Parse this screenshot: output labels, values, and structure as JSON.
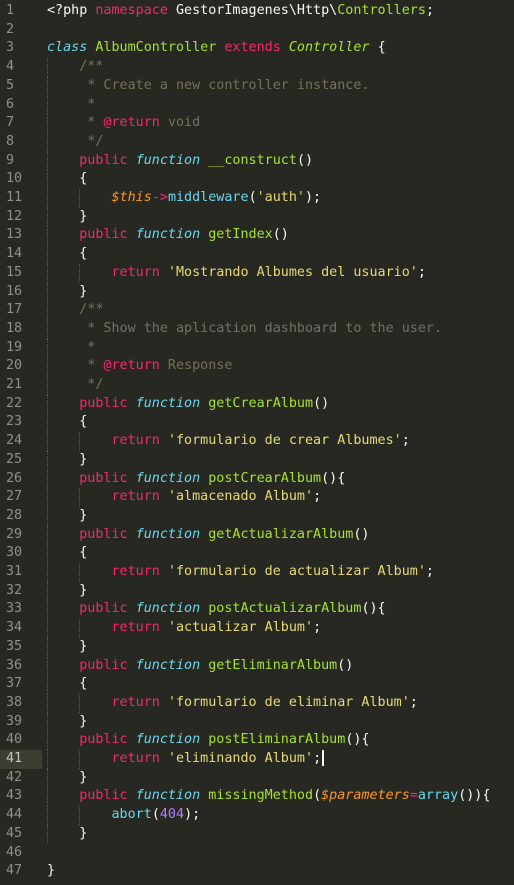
{
  "editor": {
    "theme": "monokai",
    "colors": {
      "background": "#272822",
      "line_number": "#90908a",
      "current_line": "#3e3d32",
      "keyword": "#f92672",
      "storage": "#66d9ef",
      "function_name": "#a6e22e",
      "string": "#e6db74",
      "comment": "#75715e",
      "variable": "#fd971f",
      "number": "#ae81ff"
    },
    "current_line": 41,
    "lines": [
      {
        "n": "1",
        "guides": 0,
        "tokens": [
          [
            "plain",
            "<?php "
          ],
          [
            "kw",
            "namespace "
          ],
          [
            "plain",
            "GestorImagenes\\Http\\"
          ],
          [
            "class",
            "Controllers"
          ],
          [
            "plain",
            ";"
          ]
        ]
      },
      {
        "n": "2",
        "guides": 0,
        "tokens": []
      },
      {
        "n": "3",
        "guides": 0,
        "tokens": [
          [
            "storage",
            "class "
          ],
          [
            "class",
            "AlbumController "
          ],
          [
            "kw",
            "extends "
          ],
          [
            "inherit",
            "Controller "
          ],
          [
            "plain",
            "{"
          ]
        ]
      },
      {
        "n": "4",
        "guides": 1,
        "tokens": [
          [
            "plain",
            "    "
          ],
          [
            "comment",
            "/**"
          ]
        ]
      },
      {
        "n": "5",
        "guides": 1,
        "tokens": [
          [
            "plain",
            "    "
          ],
          [
            "comment",
            " * Create a new controller instance."
          ]
        ]
      },
      {
        "n": "6",
        "guides": 1,
        "tokens": [
          [
            "plain",
            "    "
          ],
          [
            "comment",
            " *"
          ]
        ]
      },
      {
        "n": "7",
        "guides": 1,
        "tokens": [
          [
            "plain",
            "    "
          ],
          [
            "comment",
            " * "
          ],
          [
            "kw",
            "@return"
          ],
          [
            "comment",
            " void"
          ]
        ]
      },
      {
        "n": "8",
        "guides": 1,
        "tokens": [
          [
            "plain",
            "    "
          ],
          [
            "comment",
            " */"
          ]
        ]
      },
      {
        "n": "9",
        "guides": 1,
        "tokens": [
          [
            "plain",
            "    "
          ],
          [
            "kw",
            "public "
          ],
          [
            "storage",
            "function "
          ],
          [
            "func",
            "__construct"
          ],
          [
            "plain",
            "()"
          ]
        ]
      },
      {
        "n": "10",
        "guides": 1,
        "tokens": [
          [
            "plain",
            "    {"
          ]
        ]
      },
      {
        "n": "11",
        "guides": 2,
        "tokens": [
          [
            "plain",
            "        "
          ],
          [
            "var",
            "$this"
          ],
          [
            "kw",
            "->"
          ],
          [
            "support",
            "middleware"
          ],
          [
            "plain",
            "("
          ],
          [
            "string",
            "'auth'"
          ],
          [
            "plain",
            ");"
          ]
        ]
      },
      {
        "n": "12",
        "guides": 1,
        "tokens": [
          [
            "plain",
            "    }"
          ]
        ]
      },
      {
        "n": "13",
        "guides": 1,
        "tokens": [
          [
            "plain",
            "    "
          ],
          [
            "kw",
            "public "
          ],
          [
            "storage",
            "function "
          ],
          [
            "func",
            "getIndex"
          ],
          [
            "plain",
            "()"
          ]
        ]
      },
      {
        "n": "14",
        "guides": 1,
        "tokens": [
          [
            "plain",
            "    {"
          ]
        ]
      },
      {
        "n": "15",
        "guides": 2,
        "tokens": [
          [
            "plain",
            "        "
          ],
          [
            "kw",
            "return "
          ],
          [
            "string",
            "'Mostrando Albumes del usuario'"
          ],
          [
            "plain",
            ";"
          ]
        ]
      },
      {
        "n": "16",
        "guides": 1,
        "tokens": [
          [
            "plain",
            "    }"
          ]
        ]
      },
      {
        "n": "17",
        "guides": 1,
        "tokens": [
          [
            "plain",
            "    "
          ],
          [
            "comment",
            "/**"
          ]
        ]
      },
      {
        "n": "18",
        "guides": 1,
        "tokens": [
          [
            "plain",
            "    "
          ],
          [
            "comment",
            " * Show the aplication dashboard to the user."
          ]
        ]
      },
      {
        "n": "19",
        "guides": 1,
        "tokens": [
          [
            "plain",
            "    "
          ],
          [
            "comment",
            " *"
          ]
        ]
      },
      {
        "n": "20",
        "guides": 1,
        "tokens": [
          [
            "plain",
            "    "
          ],
          [
            "comment",
            " * "
          ],
          [
            "kw",
            "@return"
          ],
          [
            "comment",
            " Response"
          ]
        ]
      },
      {
        "n": "21",
        "guides": 1,
        "tokens": [
          [
            "plain",
            "    "
          ],
          [
            "comment",
            " */"
          ]
        ]
      },
      {
        "n": "22",
        "guides": 1,
        "tokens": [
          [
            "plain",
            "    "
          ],
          [
            "kw",
            "public "
          ],
          [
            "storage",
            "function "
          ],
          [
            "func",
            "getCrearAlbum"
          ],
          [
            "plain",
            "()"
          ]
        ]
      },
      {
        "n": "23",
        "guides": 1,
        "tokens": [
          [
            "plain",
            "    {"
          ]
        ]
      },
      {
        "n": "24",
        "guides": 2,
        "tokens": [
          [
            "plain",
            "        "
          ],
          [
            "kw",
            "return "
          ],
          [
            "string",
            "'formulario de crear Albumes'"
          ],
          [
            "plain",
            ";"
          ]
        ]
      },
      {
        "n": "25",
        "guides": 1,
        "tokens": [
          [
            "plain",
            "    }"
          ]
        ]
      },
      {
        "n": "26",
        "guides": 1,
        "tokens": [
          [
            "plain",
            "    "
          ],
          [
            "kw",
            "public "
          ],
          [
            "storage",
            "function "
          ],
          [
            "func",
            "postCrearAlbum"
          ],
          [
            "plain",
            "(){"
          ]
        ]
      },
      {
        "n": "27",
        "guides": 2,
        "tokens": [
          [
            "plain",
            "        "
          ],
          [
            "kw",
            "return "
          ],
          [
            "string",
            "'almacenado Album'"
          ],
          [
            "plain",
            ";"
          ]
        ]
      },
      {
        "n": "28",
        "guides": 1,
        "tokens": [
          [
            "plain",
            "    }"
          ]
        ]
      },
      {
        "n": "29",
        "guides": 1,
        "tokens": [
          [
            "plain",
            "    "
          ],
          [
            "kw",
            "public "
          ],
          [
            "storage",
            "function "
          ],
          [
            "func",
            "getActualizarAlbum"
          ],
          [
            "plain",
            "()"
          ]
        ]
      },
      {
        "n": "30",
        "guides": 1,
        "tokens": [
          [
            "plain",
            "    {"
          ]
        ]
      },
      {
        "n": "31",
        "guides": 2,
        "tokens": [
          [
            "plain",
            "        "
          ],
          [
            "kw",
            "return "
          ],
          [
            "string",
            "'formulario de actualizar Album'"
          ],
          [
            "plain",
            ";"
          ]
        ]
      },
      {
        "n": "32",
        "guides": 1,
        "tokens": [
          [
            "plain",
            "    }"
          ]
        ]
      },
      {
        "n": "33",
        "guides": 1,
        "tokens": [
          [
            "plain",
            "    "
          ],
          [
            "kw",
            "public "
          ],
          [
            "storage",
            "function "
          ],
          [
            "func",
            "postActualizarAlbum"
          ],
          [
            "plain",
            "(){"
          ]
        ]
      },
      {
        "n": "34",
        "guides": 2,
        "tokens": [
          [
            "plain",
            "        "
          ],
          [
            "kw",
            "return "
          ],
          [
            "string",
            "'actualizar Album'"
          ],
          [
            "plain",
            ";"
          ]
        ]
      },
      {
        "n": "35",
        "guides": 1,
        "tokens": [
          [
            "plain",
            "    }"
          ]
        ]
      },
      {
        "n": "36",
        "guides": 1,
        "tokens": [
          [
            "plain",
            "    "
          ],
          [
            "kw",
            "public "
          ],
          [
            "storage",
            "function "
          ],
          [
            "func",
            "getEliminarAlbum"
          ],
          [
            "plain",
            "()"
          ]
        ]
      },
      {
        "n": "37",
        "guides": 1,
        "tokens": [
          [
            "plain",
            "    {"
          ]
        ]
      },
      {
        "n": "38",
        "guides": 2,
        "tokens": [
          [
            "plain",
            "        "
          ],
          [
            "kw",
            "return "
          ],
          [
            "string",
            "'formulario de eliminar Album'"
          ],
          [
            "plain",
            ";"
          ]
        ]
      },
      {
        "n": "39",
        "guides": 1,
        "tokens": [
          [
            "plain",
            "    }"
          ]
        ]
      },
      {
        "n": "40",
        "guides": 1,
        "tokens": [
          [
            "plain",
            "    "
          ],
          [
            "kw",
            "public "
          ],
          [
            "storage",
            "function "
          ],
          [
            "func",
            "postEliminarAlbum"
          ],
          [
            "plain",
            "(){"
          ]
        ]
      },
      {
        "n": "41",
        "guides": 2,
        "tokens": [
          [
            "plain",
            "        "
          ],
          [
            "kw",
            "return "
          ],
          [
            "string",
            "'eliminando Album'"
          ],
          [
            "plain",
            ";"
          ]
        ],
        "cursor": true
      },
      {
        "n": "42",
        "guides": 1,
        "tokens": [
          [
            "plain",
            "    }"
          ]
        ]
      },
      {
        "n": "43",
        "guides": 1,
        "tokens": [
          [
            "plain",
            "    "
          ],
          [
            "kw",
            "public "
          ],
          [
            "storage",
            "function "
          ],
          [
            "func",
            "missingMethod"
          ],
          [
            "plain",
            "("
          ],
          [
            "var",
            "$parameters"
          ],
          [
            "kw",
            "="
          ],
          [
            "support",
            "array"
          ],
          [
            "plain",
            "()){"
          ]
        ]
      },
      {
        "n": "44",
        "guides": 2,
        "tokens": [
          [
            "plain",
            "        "
          ],
          [
            "support",
            "abort"
          ],
          [
            "plain",
            "("
          ],
          [
            "num",
            "404"
          ],
          [
            "plain",
            ");"
          ]
        ]
      },
      {
        "n": "45",
        "guides": 1,
        "tokens": [
          [
            "plain",
            "    }"
          ]
        ]
      },
      {
        "n": "46",
        "guides": 0,
        "tokens": []
      },
      {
        "n": "47",
        "guides": 0,
        "tokens": [
          [
            "plain",
            "}"
          ]
        ]
      }
    ]
  }
}
